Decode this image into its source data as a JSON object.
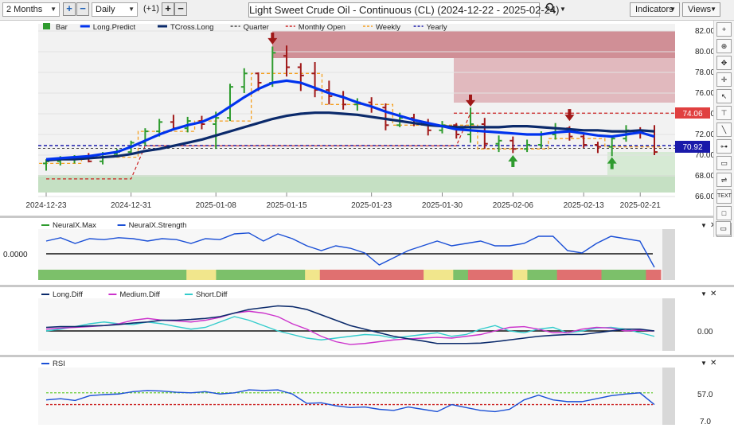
{
  "toolbar": {
    "period": "2 Months",
    "interval": "Daily",
    "offset": "(+1)",
    "title": "Light Sweet Crude Oil - Continuous (CL) (2024-12-22 - 2025-02-24)",
    "indicators_label": "Indicators",
    "views_label": "Views"
  },
  "legend_main": [
    {
      "label": "Bar",
      "color": "#2e9b2e",
      "style": "bar"
    },
    {
      "label": "Long.Predict",
      "color": "#0033ee",
      "style": "solid"
    },
    {
      "label": "TCross.Long",
      "color": "#0b2a6b",
      "style": "solid"
    },
    {
      "label": "Quarter",
      "color": "#444444",
      "style": "dash"
    },
    {
      "label": "Monthly Open",
      "color": "#cc2222",
      "style": "dash"
    },
    {
      "label": "Weekly",
      "color": "#f5a020",
      "style": "dash"
    },
    {
      "label": "Yearly",
      "color": "#1a1aaa",
      "style": "dash"
    }
  ],
  "price_axis": {
    "ticks": [
      "82.00",
      "80.00",
      "78.00",
      "76.00",
      "74.00",
      "72.00",
      "70.00",
      "68.00",
      "66.00"
    ],
    "tag_red": "74.06",
    "tag_blue": "70.92"
  },
  "date_axis": [
    "2024-12-23",
    "2024-12-31",
    "2025-01-08",
    "2025-01-15",
    "2025-01-23",
    "2025-01-30",
    "2025-02-06",
    "2025-02-13",
    "2025-02-21"
  ],
  "panel_neuralx": {
    "legend": [
      {
        "label": "NeuralX.Max",
        "color": "#2e9b2e"
      },
      {
        "label": "NeuralX.Strength",
        "color": "#1a4fd6"
      }
    ],
    "axis_label": "0.0000"
  },
  "panel_diff": {
    "legend": [
      {
        "label": "Long.Diff",
        "color": "#0b2a6b"
      },
      {
        "label": "Medium.Diff",
        "color": "#cc33cc"
      },
      {
        "label": "Short.Diff",
        "color": "#33cccc"
      }
    ],
    "axis_label": "0.00"
  },
  "panel_rsi": {
    "legend": [
      {
        "label": "RSI",
        "color": "#1a4fd6"
      }
    ],
    "axis_labels": [
      "57.0",
      "7.0"
    ]
  },
  "sidebar_icons": [
    "plus-icon",
    "zoom-in-icon",
    "pan-icon",
    "crosshair-icon",
    "cursor-icon",
    "fib-icon",
    "line-icon",
    "measure-icon",
    "note-icon",
    "channel-icon",
    "text-icon",
    "rectangle-icon",
    "circle-icon",
    "collapse-icon"
  ],
  "chart_data": {
    "type": "candlestick",
    "ylim": [
      66,
      83
    ],
    "candles": [
      {
        "o": 69.2,
        "h": 69.6,
        "l": 68.5,
        "c": 69.4
      },
      {
        "o": 69.4,
        "h": 69.9,
        "l": 69.0,
        "c": 69.6
      },
      {
        "o": 69.6,
        "h": 70.0,
        "l": 69.2,
        "c": 69.8
      },
      {
        "o": 69.8,
        "h": 70.2,
        "l": 69.3,
        "c": 69.4
      },
      {
        "o": 69.4,
        "h": 70.3,
        "l": 69.1,
        "c": 70.1
      },
      {
        "o": 70.1,
        "h": 70.6,
        "l": 69.8,
        "c": 70.3
      },
      {
        "o": 70.3,
        "h": 71.4,
        "l": 70.1,
        "c": 71.2
      },
      {
        "o": 71.2,
        "h": 72.6,
        "l": 70.9,
        "c": 72.3
      },
      {
        "o": 72.3,
        "h": 73.5,
        "l": 71.8,
        "c": 73.2
      },
      {
        "o": 73.2,
        "h": 73.9,
        "l": 72.4,
        "c": 72.6
      },
      {
        "o": 72.6,
        "h": 73.7,
        "l": 72.2,
        "c": 73.3
      },
      {
        "o": 73.3,
        "h": 73.8,
        "l": 72.5,
        "c": 73.0
      },
      {
        "o": 73.0,
        "h": 74.2,
        "l": 70.6,
        "c": 73.6
      },
      {
        "o": 73.6,
        "h": 76.9,
        "l": 73.3,
        "c": 76.6
      },
      {
        "o": 76.6,
        "h": 78.4,
        "l": 76.0,
        "c": 77.9
      },
      {
        "o": 77.9,
        "h": 78.0,
        "l": 76.2,
        "c": 77.0
      },
      {
        "o": 77.0,
        "h": 80.5,
        "l": 76.6,
        "c": 79.9
      },
      {
        "o": 79.6,
        "h": 80.6,
        "l": 77.6,
        "c": 78.5
      },
      {
        "o": 78.5,
        "h": 78.9,
        "l": 76.2,
        "c": 77.7
      },
      {
        "o": 77.9,
        "h": 79.0,
        "l": 75.6,
        "c": 76.3
      },
      {
        "o": 76.3,
        "h": 77.2,
        "l": 74.9,
        "c": 75.7
      },
      {
        "o": 75.7,
        "h": 76.2,
        "l": 74.4,
        "c": 74.9
      },
      {
        "o": 74.9,
        "h": 75.5,
        "l": 74.3,
        "c": 75.1
      },
      {
        "o": 75.1,
        "h": 75.6,
        "l": 74.1,
        "c": 74.6
      },
      {
        "o": 74.6,
        "h": 75.0,
        "l": 72.4,
        "c": 72.9
      },
      {
        "o": 72.9,
        "h": 74.1,
        "l": 72.7,
        "c": 73.6
      },
      {
        "o": 73.6,
        "h": 74.0,
        "l": 72.8,
        "c": 73.1
      },
      {
        "o": 73.1,
        "h": 73.5,
        "l": 71.9,
        "c": 72.4
      },
      {
        "o": 72.4,
        "h": 73.3,
        "l": 72.1,
        "c": 72.9
      },
      {
        "o": 72.9,
        "h": 73.1,
        "l": 71.6,
        "c": 72.0
      },
      {
        "o": 72.0,
        "h": 74.6,
        "l": 71.2,
        "c": 73.0
      },
      {
        "o": 73.0,
        "h": 73.6,
        "l": 70.6,
        "c": 71.1
      },
      {
        "o": 71.1,
        "h": 71.9,
        "l": 70.3,
        "c": 71.4
      },
      {
        "o": 71.4,
        "h": 71.8,
        "l": 70.2,
        "c": 70.6
      },
      {
        "o": 70.6,
        "h": 71.5,
        "l": 70.3,
        "c": 71.0
      },
      {
        "o": 71.0,
        "h": 72.3,
        "l": 70.7,
        "c": 72.0
      },
      {
        "o": 72.0,
        "h": 73.1,
        "l": 71.5,
        "c": 72.6
      },
      {
        "o": 72.6,
        "h": 72.8,
        "l": 71.4,
        "c": 71.8
      },
      {
        "o": 71.8,
        "h": 72.0,
        "l": 70.7,
        "c": 71.0
      },
      {
        "o": 71.0,
        "h": 71.3,
        "l": 70.2,
        "c": 70.8
      },
      {
        "o": 70.8,
        "h": 71.9,
        "l": 69.9,
        "c": 71.6
      },
      {
        "o": 71.6,
        "h": 72.9,
        "l": 71.3,
        "c": 72.4
      },
      {
        "o": 72.4,
        "h": 72.7,
        "l": 71.6,
        "c": 72.3
      },
      {
        "o": 72.3,
        "h": 72.9,
        "l": 70.0,
        "c": 70.3
      }
    ],
    "long_predict": [
      69.6,
      69.7,
      69.8,
      69.9,
      70.1,
      70.3,
      70.8,
      71.4,
      72.0,
      72.5,
      72.9,
      73.2,
      73.8,
      74.7,
      75.6,
      76.4,
      77.0,
      77.2,
      77.0,
      76.5,
      76.0,
      75.6,
      75.1,
      74.7,
      74.2,
      73.8,
      73.4,
      73.1,
      72.8,
      72.5,
      72.4,
      72.3,
      72.2,
      72.1,
      72.0,
      72.0,
      72.2,
      72.3,
      72.1,
      71.9,
      71.8,
      72.0,
      72.2,
      71.8
    ],
    "tcross_long": [
      69.5,
      69.6,
      69.6,
      69.7,
      69.8,
      69.9,
      70.1,
      70.4,
      70.6,
      70.9,
      71.2,
      71.5,
      71.9,
      72.3,
      72.7,
      73.1,
      73.5,
      73.8,
      74.0,
      74.1,
      74.1,
      74.0,
      73.9,
      73.7,
      73.5,
      73.3,
      73.1,
      72.9,
      72.8,
      72.7,
      72.7,
      72.7,
      72.7,
      72.8,
      72.8,
      72.7,
      72.6,
      72.5,
      72.4,
      72.4,
      72.3,
      72.3,
      72.4,
      72.3
    ],
    "weekly": [
      69.2,
      69.2,
      69.2,
      69.8,
      69.8,
      69.8,
      69.8,
      72.3,
      72.3,
      72.3,
      72.3,
      73.3,
      73.3,
      73.3,
      73.3,
      77.9,
      77.9,
      77.9,
      77.9,
      77.9,
      74.9,
      74.9,
      74.9,
      74.9,
      74.9,
      72.9,
      72.9,
      72.9,
      72.9,
      72.9,
      72.9,
      70.6,
      70.6,
      70.6,
      70.6,
      70.6,
      71.6,
      71.6,
      71.6,
      71.6,
      70.8,
      70.8,
      70.8,
      70.8
    ],
    "monthly_open": 74.06,
    "yearly": 70.92,
    "neuralx_strength": [
      0.55,
      0.62,
      0.5,
      0.6,
      0.58,
      0.62,
      0.6,
      0.55,
      0.6,
      0.58,
      0.5,
      0.6,
      0.58,
      0.7,
      0.72,
      0.55,
      0.7,
      0.6,
      0.45,
      0.35,
      0.45,
      0.4,
      0.3,
      0.05,
      0.2,
      0.35,
      0.45,
      0.55,
      0.45,
      0.5,
      0.55,
      0.45,
      0.45,
      0.5,
      0.65,
      0.65,
      0.35,
      0.3,
      0.5,
      0.65,
      0.6,
      0.55,
      0.0
    ],
    "neuralx_max": [
      "g",
      "g",
      "g",
      "g",
      "g",
      "g",
      "g",
      "g",
      "g",
      "g",
      "y",
      "y",
      "g",
      "g",
      "g",
      "g",
      "g",
      "g",
      "y",
      "r",
      "r",
      "r",
      "r",
      "r",
      "r",
      "r",
      "y",
      "y",
      "g",
      "r",
      "r",
      "r",
      "y",
      "g",
      "g",
      "r",
      "r",
      "r",
      "g",
      "g",
      "g",
      "r"
    ],
    "long_diff": [
      0.1,
      0.12,
      0.12,
      0.14,
      0.15,
      0.18,
      0.22,
      0.25,
      0.3,
      0.3,
      0.32,
      0.35,
      0.4,
      0.5,
      0.6,
      0.65,
      0.7,
      0.68,
      0.6,
      0.45,
      0.3,
      0.15,
      0.05,
      -0.05,
      -0.15,
      -0.22,
      -0.28,
      -0.35,
      -0.35,
      -0.35,
      -0.34,
      -0.3,
      -0.25,
      -0.2,
      -0.15,
      -0.12,
      -0.1,
      -0.1,
      -0.05,
      0,
      0.05,
      0.05,
      0.0
    ],
    "medium_diff": [
      0.05,
      0.08,
      0.1,
      0.12,
      0.15,
      0.2,
      0.3,
      0.35,
      0.3,
      0.28,
      0.25,
      0.3,
      0.38,
      0.5,
      0.55,
      0.5,
      0.4,
      0.2,
      0.05,
      -0.15,
      -0.3,
      -0.38,
      -0.35,
      -0.3,
      -0.25,
      -0.22,
      -0.2,
      -0.18,
      -0.2,
      -0.15,
      -0.1,
      0.0,
      0.1,
      0.12,
      0.05,
      -0.05,
      -0.05,
      0.05,
      0.1,
      0.08,
      0.0,
      0.02,
      0.0
    ],
    "short_diff": [
      0.0,
      0.05,
      0.12,
      0.2,
      0.25,
      0.2,
      0.18,
      0.25,
      0.2,
      0.12,
      0.05,
      0.1,
      0.25,
      0.4,
      0.3,
      0.15,
      0.0,
      -0.1,
      -0.2,
      -0.25,
      -0.2,
      -0.15,
      -0.1,
      -0.12,
      -0.2,
      -0.15,
      -0.1,
      -0.05,
      -0.15,
      -0.1,
      0.05,
      0.15,
      0.0,
      -0.05,
      0.05,
      0.1,
      -0.05,
      0.0,
      0.08,
      0.1,
      0.05,
      -0.05,
      -0.15
    ],
    "rsi": [
      48,
      50,
      47,
      55,
      57,
      58,
      62,
      64,
      63,
      61,
      60,
      62,
      58,
      60,
      65,
      64,
      65,
      58,
      42,
      43,
      38,
      35,
      36,
      32,
      30,
      36,
      32,
      28,
      40,
      35,
      30,
      28,
      32,
      48,
      56,
      48,
      45,
      45,
      50,
      55,
      58,
      60,
      40
    ]
  }
}
